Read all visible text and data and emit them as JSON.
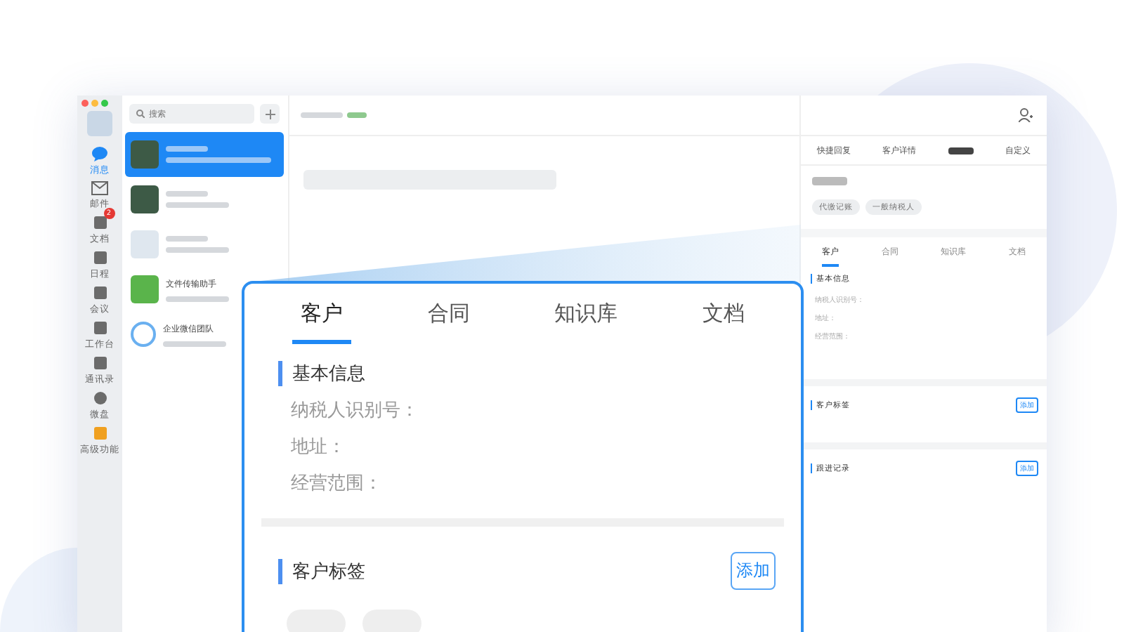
{
  "rail": {
    "items": [
      {
        "label": "消息",
        "selected": true
      },
      {
        "label": "邮件",
        "selected": false
      },
      {
        "label": "文档",
        "selected": false,
        "badge": "2"
      },
      {
        "label": "日程",
        "selected": false
      },
      {
        "label": "会议",
        "selected": false
      },
      {
        "label": "工作台",
        "selected": false
      },
      {
        "label": "通讯录",
        "selected": false
      },
      {
        "label": "微盘",
        "selected": false
      },
      {
        "label": "高级功能",
        "selected": false
      }
    ]
  },
  "search": {
    "placeholder": "搜索"
  },
  "chats": [
    {
      "kind": "photo",
      "selected": true
    },
    {
      "kind": "photo",
      "selected": false
    },
    {
      "kind": "doc",
      "selected": false
    },
    {
      "kind": "folder",
      "selected": false,
      "name": "文件传输助手"
    },
    {
      "kind": "logo",
      "selected": false,
      "name": "企业微信团队"
    }
  ],
  "side_panel": {
    "top_tabs": [
      {
        "label": "快捷回复",
        "selected": false
      },
      {
        "label": "客户详情",
        "selected": false
      },
      {
        "selected": true
      },
      {
        "label": "自定义",
        "selected": false
      }
    ],
    "tags": [
      "代缴记账",
      "一般纳税人"
    ],
    "tabs": [
      {
        "label": "客户",
        "selected": true
      },
      {
        "label": "合同",
        "selected": false
      },
      {
        "label": "知识库",
        "selected": false
      },
      {
        "label": "文档",
        "selected": false
      }
    ],
    "basic_info": {
      "title": "基本信息",
      "fields": [
        "纳税人识别号：",
        "地址：",
        "经营范围："
      ]
    },
    "sections": [
      {
        "title": "客户标签",
        "button": "添加"
      },
      {
        "title": "跟进记录",
        "button": "添加"
      }
    ]
  },
  "zoom_card": {
    "tabs": [
      {
        "label": "客户",
        "selected": true
      },
      {
        "label": "合同",
        "selected": false
      },
      {
        "label": "知识库",
        "selected": false
      },
      {
        "label": "文档",
        "selected": false
      }
    ],
    "basic_info": {
      "title": "基本信息",
      "fields": [
        "纳税人识别号：",
        "地址：",
        "经营范围："
      ]
    },
    "tag_section": {
      "title": "客户标签",
      "button": "添加",
      "tags": [
        {
          "kind": "pill"
        },
        {
          "kind": "pill"
        }
      ]
    }
  }
}
